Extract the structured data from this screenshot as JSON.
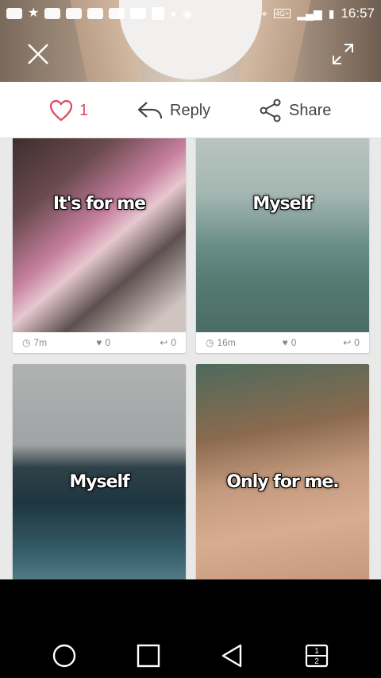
{
  "status_bar": {
    "time": "16:57",
    "network_label": "4G+",
    "notification_icons": [
      "messaging-icon",
      "star-icon",
      "youtube-icon",
      "youtube-icon",
      "youtube-icon",
      "youtube-icon",
      "youtube-icon",
      "image-icon",
      "drop-icon",
      "vpn-icon"
    ],
    "system_icons": [
      "location-icon",
      "network-icon",
      "signal-icon",
      "battery-icon"
    ]
  },
  "header": {
    "close_icon": "close-icon",
    "expand_icon": "expand-icon"
  },
  "actions": {
    "like_icon": "heart-icon",
    "like_count": "1",
    "reply_label": "Reply",
    "share_label": "Share"
  },
  "cards": [
    {
      "caption": "It's for me",
      "time": "7m",
      "hearts": "0",
      "replies": "0"
    },
    {
      "caption": "Myself",
      "time": "16m",
      "hearts": "0",
      "replies": "0"
    },
    {
      "caption": "Myself"
    },
    {
      "caption": "Only for me."
    }
  ],
  "nav_bar": {
    "items": [
      "home-circle-icon",
      "recents-square-icon",
      "back-triangle-icon",
      "dual-window-icon"
    ],
    "dual_window_top": "1",
    "dual_window_bottom": "2"
  },
  "colors": {
    "accent_heart": "#e04860",
    "text_gray": "#444444",
    "meta_gray": "#888888"
  }
}
